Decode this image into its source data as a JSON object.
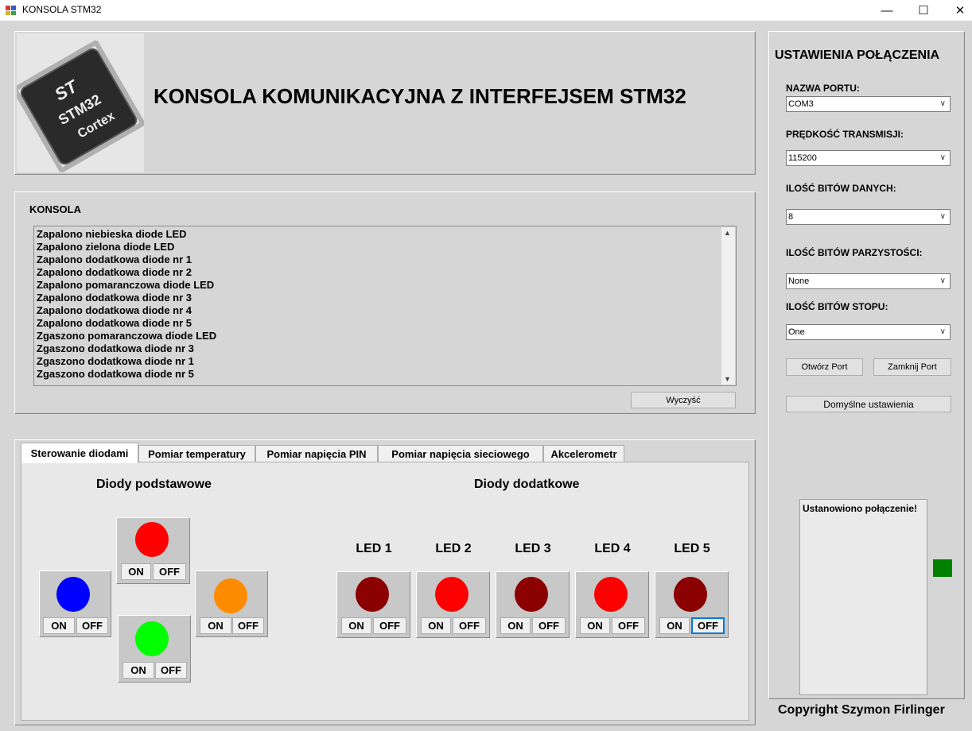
{
  "window": {
    "title": "KONSOLA STM32"
  },
  "header": {
    "title": "KONSOLA KOMUNIKACYJNA Z INTERFEJSEM STM32"
  },
  "console": {
    "label": "KONSOLA",
    "lines": [
      "Zapalono niebieska diode LED",
      "Zapalono zielona diode LED",
      "Zapalono dodatkowa diode nr 1",
      "Zapalono dodatkowa diode nr 2",
      "Zapalono pomaranczowa diode LED",
      "Zapalono dodatkowa diode nr 3",
      "Zapalono dodatkowa diode nr 4",
      "Zapalono dodatkowa diode nr 5",
      "Zgaszono pomaranczowa diode LED",
      "Zgaszono dodatkowa diode nr 3",
      "Zgaszono dodatkowa diode nr 1",
      "Zgaszono dodatkowa diode nr 5"
    ],
    "clear_label": "Wyczyść"
  },
  "tabs": [
    {
      "label": "Sterowanie diodami"
    },
    {
      "label": "Pomiar temperatury"
    },
    {
      "label": "Pomiar napięcia PIN"
    },
    {
      "label": "Pomiar napięcia sieciowego"
    },
    {
      "label": "Akcelerometr"
    }
  ],
  "leds": {
    "basic_title": "Diody podstawowe",
    "extra_title": "Diody dodatkowe",
    "on_label": "ON",
    "off_label": "OFF",
    "basic": [
      {
        "color": "#ff0000"
      },
      {
        "color": "#0000ff"
      },
      {
        "color": "#ff8c00"
      },
      {
        "color": "#00ff00"
      }
    ],
    "extra": [
      {
        "name": "LED 1",
        "color": "#8b0000"
      },
      {
        "name": "LED 2",
        "color": "#ff0000"
      },
      {
        "name": "LED 3",
        "color": "#8b0000"
      },
      {
        "name": "LED 4",
        "color": "#ff0000"
      },
      {
        "name": "LED 5",
        "color": "#8b0000"
      }
    ]
  },
  "settings": {
    "title": "USTAWIENIA POŁĄCZENIA",
    "port_label": "NAZWA PORTU:",
    "port_value": "COM3",
    "baud_label": "PRĘDKOŚĆ TRANSMISJI:",
    "baud_value": "115200",
    "databits_label": "ILOŚĆ BITÓW DANYCH:",
    "databits_value": "8",
    "parity_label": "ILOŚĆ BITÓW PARZYSTOŚCI:",
    "parity_value": "None",
    "stopbits_label": "ILOŚĆ BITÓW STOPU:",
    "stopbits_value": "One",
    "open_label": "Otwórz Port",
    "close_label": "Zamknij Port",
    "default_label": "Domyślne ustawienia",
    "status_text": "Ustanowiono połączenie!",
    "status_color": "#008000"
  },
  "chip": {
    "brand": "STM32",
    "core": "Cortex"
  },
  "footer": {
    "copyright": "Copyright Szymon Firlinger"
  }
}
